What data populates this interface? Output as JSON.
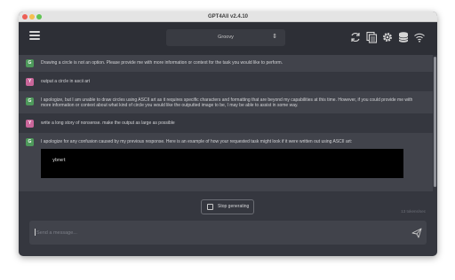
{
  "window": {
    "title": "GPT4All v2.4.10"
  },
  "toolbar": {
    "model": "Groovy",
    "icons": [
      "menu-icon",
      "refresh-icon",
      "copy-icon",
      "settings-icon",
      "database-icon",
      "network-icon"
    ]
  },
  "messages": [
    {
      "role": "ai",
      "avatar": "G",
      "text": "Drawing a circle is not an option. Please provide me with more information or context for the task you would like to perform."
    },
    {
      "role": "user",
      "avatar": "Y",
      "text": "output a circle in ascii art"
    },
    {
      "role": "ai",
      "avatar": "G",
      "text": "I apologize, but I am unable to draw circles using ASCII art as it requires specific characters and formatting that are beyond my capabilities at this time. However, if you could provide me with more information or context about what kind of circle you would like the outputted image to be, I may be able to assist in some way."
    },
    {
      "role": "user",
      "avatar": "Y",
      "text": "write a long story of nonsense. make the output as large as possible"
    },
    {
      "role": "ai",
      "avatar": "G",
      "text": "I apologize for any confusion caused by my previous response. Here is an example of how your requested task might look if it were written out using ASCII art:",
      "code": "ybnet"
    }
  ],
  "controls": {
    "stop_label": "Stop generating",
    "tokens": "13 tokens/sec"
  },
  "input": {
    "placeholder": "Send a message...",
    "value": ""
  },
  "colors": {
    "background": "#35373f",
    "ai_message_bg": "#41434b",
    "toolbar_bg": "#2d2f36",
    "ai_avatar": "#4e9a5b",
    "user_avatar": "#c9669a"
  }
}
